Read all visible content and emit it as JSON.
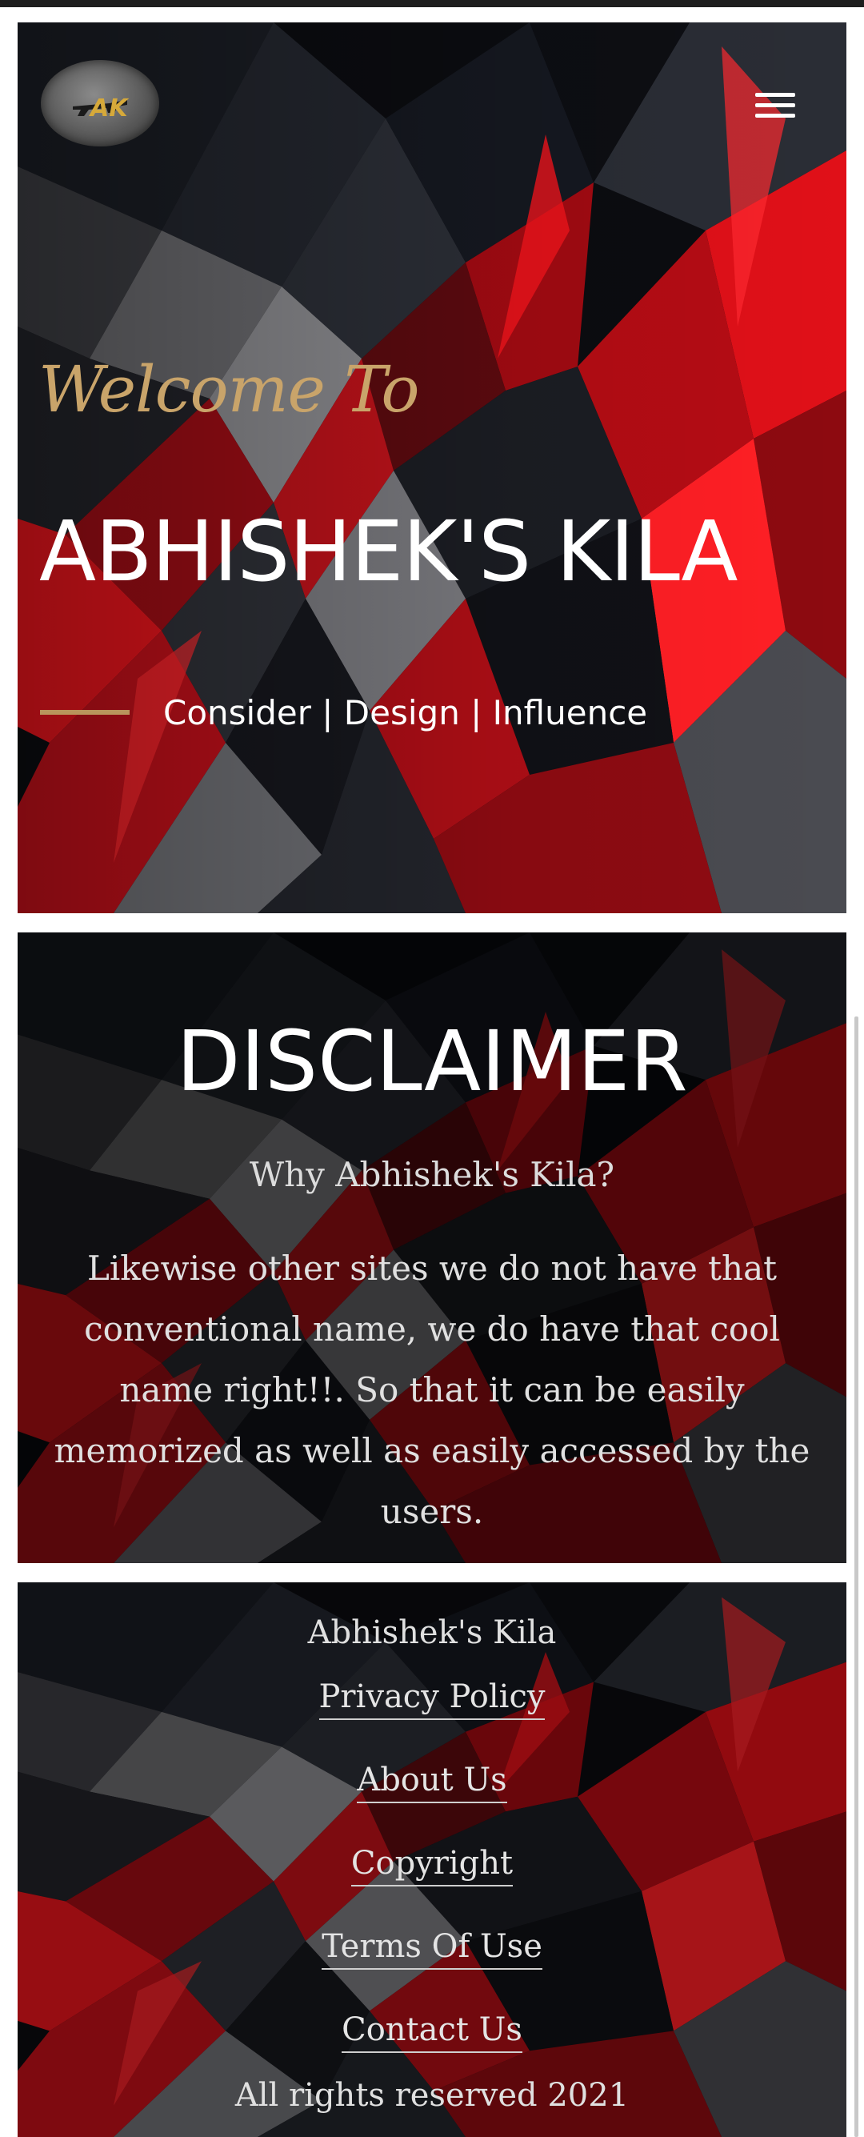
{
  "brand": {
    "logo_letters": "AK",
    "logo_icon": "rifle-logo-icon"
  },
  "hero": {
    "welcome": "Welcome To",
    "title": "ABHISHEK'S KILA",
    "tagline": "Consider | Design | Influence",
    "menu_icon": "hamburger-menu-icon"
  },
  "disclaimer": {
    "heading": "DISCLAIMER",
    "subheading": "Why Abhishek's Kila?",
    "body": "Likewise other sites we do not have that conventional name, we do have that cool name right!!. So that it can be easily memorized as well as easily accessed by the users."
  },
  "footer": {
    "brand": "Abhishek's Kila",
    "links": [
      "Privacy Policy",
      "About Us",
      "Copyright",
      "Terms Of Use",
      "Contact Us"
    ],
    "copyright": "All rights reserved 2021"
  },
  "colors": {
    "accent_gold": "#c9a46a",
    "accent_red": "#d90f1a",
    "background_dark": "#0a0a0d",
    "text_light": "#ffffff"
  }
}
